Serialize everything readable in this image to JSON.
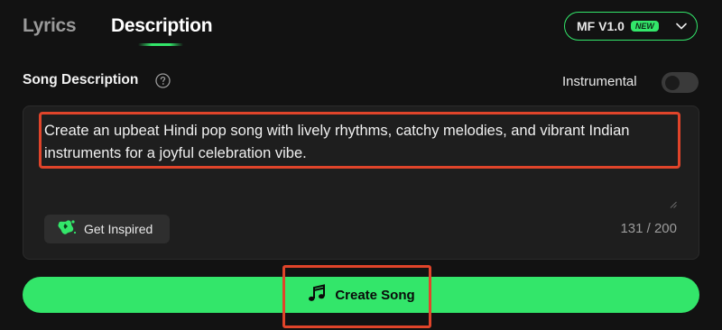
{
  "tabs": {
    "lyrics": "Lyrics",
    "description": "Description",
    "active": "Description"
  },
  "model": {
    "label": "MF V1.0",
    "badge": "NEW"
  },
  "song_description": {
    "title": "Song Description",
    "text": "Create an upbeat Hindi pop song with lively rhythms, catchy melodies, and vibrant Indian instruments for a joyful celebration vibe.",
    "counter": "131 / 200"
  },
  "instrumental": {
    "label": "Instrumental",
    "enabled": false
  },
  "get_inspired": {
    "label": "Get Inspired"
  },
  "create_song": {
    "label": "Create Song"
  },
  "colors": {
    "accent": "#33e66a",
    "background": "#121212",
    "panel": "#1e1e1e",
    "highlight": "#e0442a"
  }
}
